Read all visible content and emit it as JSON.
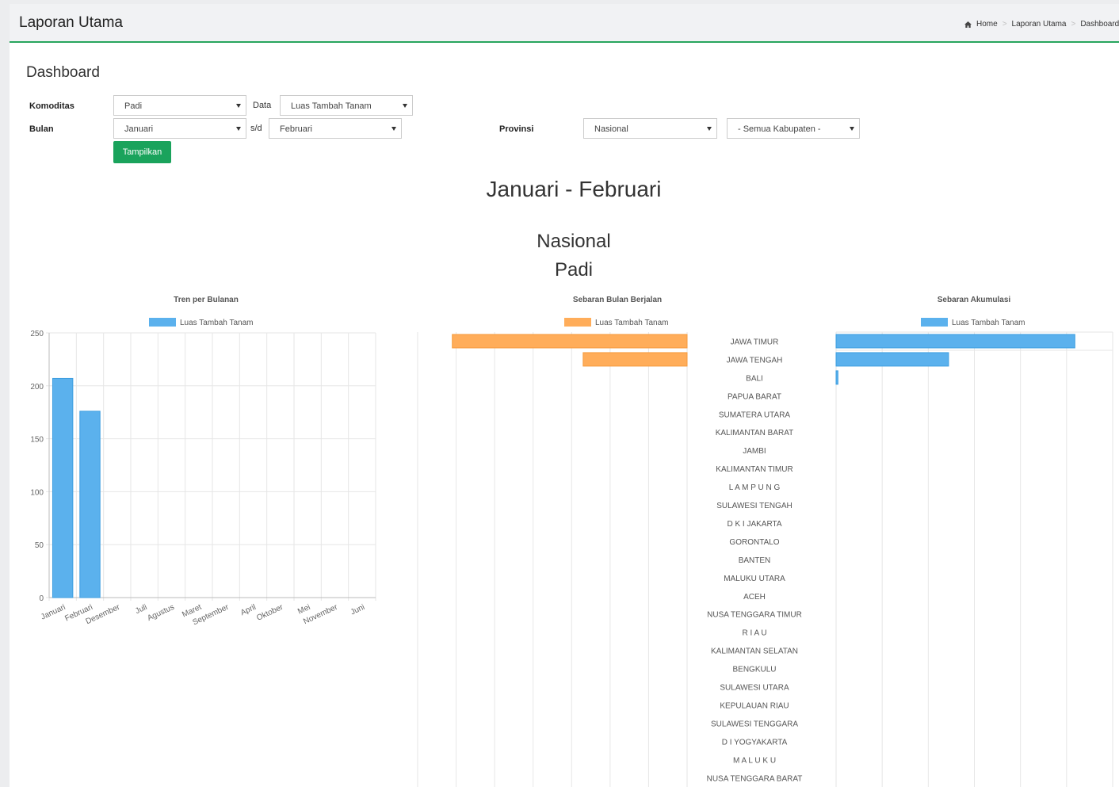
{
  "header": {
    "title": "Laporan Utama",
    "breadcrumb": [
      "Home",
      "Laporan Utama",
      "Dashboard L"
    ]
  },
  "page": {
    "title": "Dashboard"
  },
  "filters": {
    "komoditas_label": "Komoditas",
    "komoditas_value": "Padi",
    "data_label": "Data",
    "data_value": "Luas Tambah Tanam",
    "bulan_label": "Bulan",
    "bulan_from": "Januari",
    "sd_label": "s/d",
    "bulan_to": "Februari",
    "provinsi_label": "Provinsi",
    "provinsi_value": "Nasional",
    "kabupaten_value": "- Semua Kabupaten -",
    "submit_label": "Tampilkan"
  },
  "report": {
    "period": "Januari - Februari",
    "region": "Nasional",
    "komoditas": "Padi"
  },
  "colors": {
    "blue": "#5bb1ed",
    "orange": "#ffad5a",
    "green": "#1aa35c"
  },
  "chart_data": [
    {
      "type": "bar",
      "title": "Tren per Bulanan",
      "categories": [
        "Januari",
        "Februari",
        "Desember",
        "Juli",
        "Agustus",
        "Maret",
        "September",
        "April",
        "Oktober",
        "Mei",
        "November",
        "Juni"
      ],
      "series": [
        {
          "name": "Luas Tambah Tanam",
          "values": [
            207,
            176,
            0,
            0,
            0,
            0,
            0,
            0,
            0,
            0,
            0,
            0
          ]
        }
      ],
      "ylim": [
        0,
        250
      ],
      "yticks": [
        0,
        50,
        100,
        150,
        200,
        250
      ],
      "grid": true,
      "legend": "top"
    },
    {
      "type": "bar",
      "orientation": "horizontal-reversed",
      "title": "Sebaran Bulan Berjalan",
      "categories": [
        "JAWA TIMUR",
        "JAWA TENGAH",
        "BALI",
        "PAPUA BARAT",
        "SUMATERA UTARA",
        "KALIMANTAN BARAT",
        "JAMBI",
        "KALIMANTAN TIMUR",
        "L A M P U N G",
        "SULAWESI TENGAH",
        "D K I  JAKARTA",
        "GORONTALO",
        "BANTEN",
        "MALUKU UTARA",
        "ACEH",
        "NUSA TENGGARA TIMUR",
        "R I A U",
        "KALIMANTAN SELATAN",
        "BENGKULU",
        "SULAWESI UTARA",
        "KEPULAUAN RIAU",
        "SULAWESI TENGGARA",
        "D I YOGYAKARTA",
        "M A L U K U",
        "NUSA TENGGARA BARAT"
      ],
      "series": [
        {
          "name": "Luas Tambah Tanam",
          "values": [
            6.1,
            2.7,
            0,
            0,
            0,
            0,
            0,
            0,
            0,
            0,
            0,
            0,
            0,
            0,
            0,
            0,
            0,
            0,
            0,
            0,
            0,
            0,
            0,
            0,
            0
          ]
        }
      ],
      "xlim": [
        0,
        7
      ],
      "grid": true,
      "legend": "top"
    },
    {
      "type": "bar",
      "orientation": "horizontal",
      "title": "Sebaran Akumulasi",
      "categories": [
        "JAWA TIMUR",
        "JAWA TENGAH",
        "BALI",
        "PAPUA BARAT",
        "SUMATERA UTARA",
        "KALIMANTAN BARAT",
        "JAMBI",
        "KALIMANTAN TIMUR",
        "L A M P U N G",
        "SULAWESI TENGAH",
        "D K I  JAKARTA",
        "GORONTALO",
        "BANTEN",
        "MALUKU UTARA",
        "ACEH",
        "NUSA TENGGARA TIMUR",
        "R I A U",
        "KALIMANTAN SELATAN",
        "BENGKULU",
        "SULAWESI UTARA",
        "KEPULAUAN RIAU",
        "SULAWESI TENGGARA",
        "D I YOGYAKARTA",
        "M A L U K U",
        "NUSA TENGGARA BARAT"
      ],
      "series": [
        {
          "name": "Luas Tambah Tanam",
          "values": [
            259,
            122,
            2,
            0,
            0,
            0,
            0,
            0,
            0,
            0,
            0,
            0,
            0,
            0,
            0,
            0,
            0,
            0,
            0,
            0,
            0,
            0,
            0,
            0,
            0
          ]
        }
      ],
      "xlim": [
        0,
        300
      ],
      "grid": true,
      "legend": "top"
    }
  ]
}
